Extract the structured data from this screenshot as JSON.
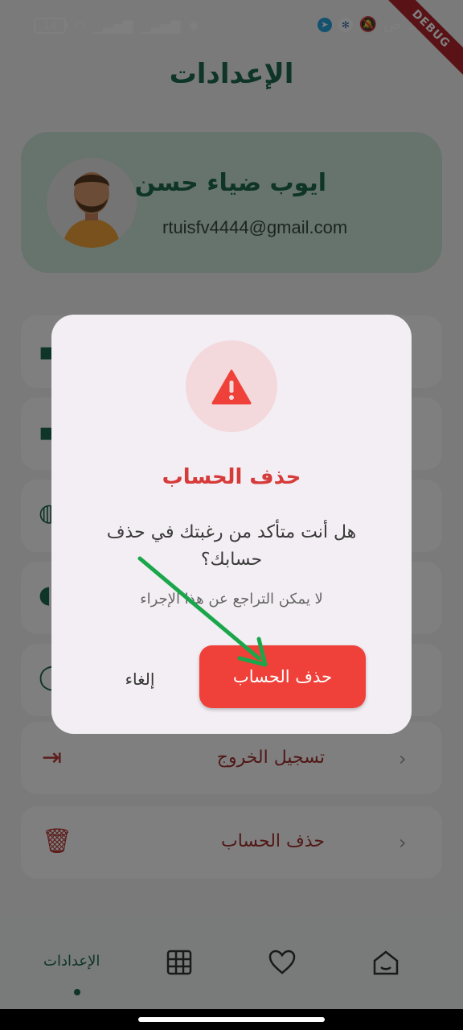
{
  "status_bar": {
    "battery": "14",
    "time": "3:0",
    "am_pm": "ص",
    "debug_ribbon": "DEBUG"
  },
  "page": {
    "title": "الإعدادات"
  },
  "profile": {
    "name": "ايوب ضياء حسن",
    "email": "rtuisfv4444@gmail.com"
  },
  "menu": {
    "logout_label": "تسجيل الخروج",
    "delete_account_label": "حذف الحساب"
  },
  "dialog": {
    "title": "حذف الحساب",
    "message": "هل أنت متأكد من رغبتك في حذف حسابك؟",
    "note": "لا يمكن التراجع عن هذا الإجراء",
    "cancel_label": "إلغاء",
    "confirm_label": "حذف الحساب"
  },
  "bottom_nav": {
    "settings_label": "الإعدادات"
  },
  "colors": {
    "primary": "#1d6b4e",
    "danger": "#ef4139",
    "annotation_arrow": "#1aa64a"
  },
  "icons": [
    "warning-icon",
    "logout-icon",
    "trash-icon",
    "grid-icon",
    "heart-icon",
    "home-icon",
    "chevron-right-icon"
  ]
}
